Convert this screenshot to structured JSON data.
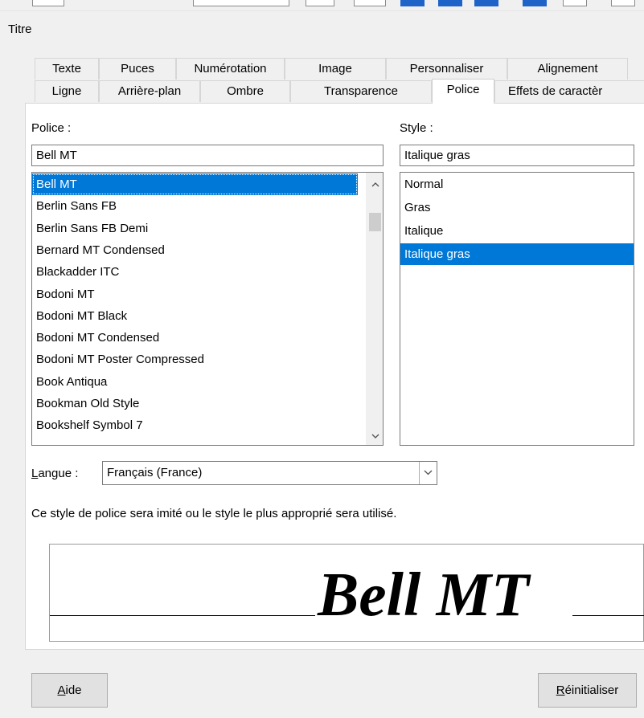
{
  "window": {
    "title": "Titre"
  },
  "tabs_row1": [
    "Texte",
    "Puces",
    "Numérotation",
    "Image",
    "Personnaliser",
    "Alignement"
  ],
  "tabs_row2": [
    "Ligne",
    "Arrière-plan",
    "Ombre",
    "Transparence",
    "Police",
    "Effets de caractèr"
  ],
  "active_tab": "Police",
  "font": {
    "label": "Police :",
    "value": "Bell MT",
    "list": [
      "Bell MT",
      "Berlin Sans FB",
      "Berlin Sans FB Demi",
      "Bernard MT Condensed",
      "Blackadder ITC",
      "Bodoni MT",
      "Bodoni MT Black",
      "Bodoni MT Condensed",
      "Bodoni MT Poster Compressed",
      "Book Antiqua",
      "Bookman Old Style",
      "Bookshelf Symbol 7"
    ],
    "selected": "Bell MT"
  },
  "style": {
    "label": "Style :",
    "value": "Italique gras",
    "list": [
      "Normal",
      "Gras",
      "Italique",
      "Italique gras"
    ],
    "selected": "Italique gras"
  },
  "language": {
    "label_first": "L",
    "label_rest": "angue :",
    "value": "Français (France)"
  },
  "note": "Ce style de police sera imité ou le style le plus approprié sera utilisé.",
  "preview": {
    "text": "Bell MT"
  },
  "buttons": {
    "help_first": "A",
    "help_rest": "ide",
    "reset_first": "R",
    "reset_rest": "éinitialiser"
  },
  "icons": {
    "scroll_up": "chevron-up-icon",
    "scroll_down": "chevron-down-icon",
    "dropdown": "chevron-down-icon"
  },
  "colors": {
    "selection": "#0078d7",
    "dialog_bg": "#f0f0f0"
  }
}
